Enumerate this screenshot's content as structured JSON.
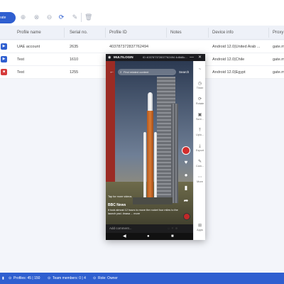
{
  "toolbar": {
    "create_label": "reate",
    "icons": [
      "add-circle-icon",
      "remove-circle-icon",
      "zoom-out-icon",
      "refresh-icon",
      "edit-icon",
      "trash-icon"
    ]
  },
  "table": {
    "headers": [
      "Profile name",
      "Serial no.",
      "Profile ID",
      "Notes",
      "Device info",
      "Proxy"
    ],
    "rows": [
      {
        "status": "play",
        "name": "UAE account",
        "serial": "2635",
        "profile_id": "403787372837762494",
        "notes": "",
        "device": "Android 12.0|United Arab ...",
        "proxy": "gate.m"
      },
      {
        "status": "play",
        "name": "Test",
        "serial": "1610",
        "profile_id": "",
        "notes": "",
        "device": "Android 12.0|Chile",
        "proxy": "gate.m"
      },
      {
        "status": "stop",
        "name": "Test",
        "serial": "1255",
        "profile_id": "",
        "notes": "",
        "device": "Android 12.0|Egypt",
        "proxy": "gate.m"
      }
    ]
  },
  "footer": {
    "profiles": "Profiles: 45 | 150",
    "team": "Team members: 0 | 4",
    "role": "Role: Owner"
  },
  "phone": {
    "brand": "MULTILOGIN",
    "device_id": "ID 403787372837762494 4d8d8c...",
    "minimize": "—",
    "close": "✕",
    "search_placeholder": "Find related content",
    "search_link": "Search",
    "tap_hint": "Tap for more videos",
    "author": "BBC News",
    "caption": "It took almost 12 hours to move the rocket four miles to the launch pad. #nasa ... more",
    "comment_placeholder": "Add comment...",
    "sidebar": [
      {
        "icon": "~",
        "label": ""
      },
      {
        "icon": "◷",
        "label": "Timer"
      },
      {
        "icon": "⟳",
        "label": "Rotate"
      },
      {
        "icon": "▣",
        "label": "Scre..."
      },
      {
        "icon": "⤒",
        "label": "Uplo..."
      },
      {
        "icon": "⤓",
        "label": "Export"
      },
      {
        "icon": "✎",
        "label": "Cam..."
      },
      {
        "icon": "⋯",
        "label": "More"
      },
      {
        "icon": "⊞",
        "label": "Apps"
      }
    ]
  },
  "colors": {
    "accent": "#2f5fd0",
    "stop": "#d63b3b",
    "titlebar": "#1b1b1f"
  }
}
